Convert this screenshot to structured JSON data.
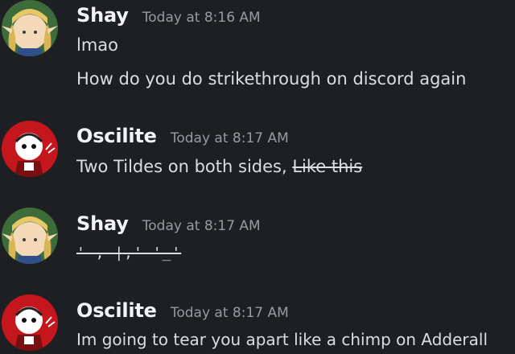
{
  "messages": [
    {
      "author": "Shay",
      "timestamp": "Today at 8:16 AM",
      "lines": [
        "lmao",
        "How do you do strikethrough on discord again"
      ]
    },
    {
      "author": "Oscilite",
      "timestamp": "Today at 8:17 AM",
      "text_plain": "Two Tildes on both sides, ",
      "text_strike": "Like this"
    },
    {
      "author": "Shay",
      "timestamp": "Today at 8:17 AM",
      "text_strike": "' , |,' '_'"
    },
    {
      "author": "Oscilite",
      "timestamp": "Today at 8:17 AM",
      "text": "Im going to tear you apart like a chimp on Adderall"
    }
  ],
  "colors": {
    "background": "#1e1f22",
    "username": "#f2f3f5",
    "timestamp": "#949ba4",
    "message_text": "#dbdee1"
  },
  "icons": {
    "shay_avatar": "elf-girl-avatar-icon",
    "oscilite_avatar": "red-character-avatar-icon"
  }
}
